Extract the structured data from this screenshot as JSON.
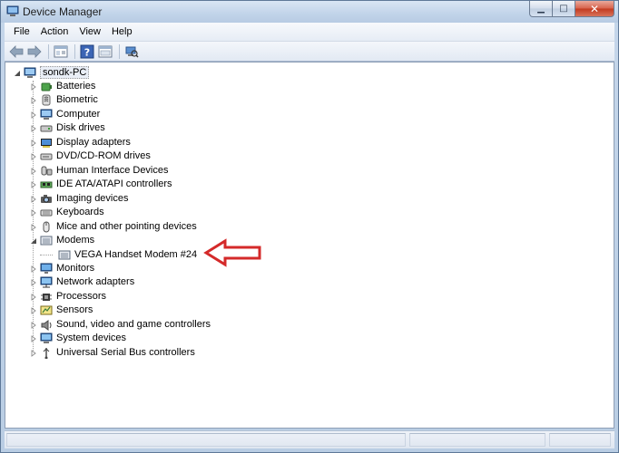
{
  "window": {
    "title": "Device Manager"
  },
  "caption": {
    "minimize": "▁",
    "maximize": "□",
    "close": "✕"
  },
  "menu": [
    "File",
    "Action",
    "View",
    "Help"
  ],
  "toolbar": [
    "back-arrow-icon",
    "forward-arrow-icon",
    "properties-icon",
    "help-icon",
    "show-hidden-icon",
    "scan-hardware-icon"
  ],
  "tree": {
    "root": "sondk-PC",
    "categories": [
      {
        "label": "Batteries",
        "icon": "battery-icon",
        "expanded": false
      },
      {
        "label": "Biometric",
        "icon": "biometric-icon",
        "expanded": false
      },
      {
        "label": "Computer",
        "icon": "computer-icon",
        "expanded": false
      },
      {
        "label": "Disk drives",
        "icon": "disk-drive-icon",
        "expanded": false
      },
      {
        "label": "Display adapters",
        "icon": "display-adapter-icon",
        "expanded": false
      },
      {
        "label": "DVD/CD-ROM drives",
        "icon": "dvd-drive-icon",
        "expanded": false
      },
      {
        "label": "Human Interface Devices",
        "icon": "hid-icon",
        "expanded": false
      },
      {
        "label": "IDE ATA/ATAPI controllers",
        "icon": "ide-controller-icon",
        "expanded": false
      },
      {
        "label": "Imaging devices",
        "icon": "camera-icon",
        "expanded": false
      },
      {
        "label": "Keyboards",
        "icon": "keyboard-icon",
        "expanded": false
      },
      {
        "label": "Mice and other pointing devices",
        "icon": "mouse-icon",
        "expanded": false
      },
      {
        "label": "Modems",
        "icon": "modem-icon",
        "expanded": true,
        "children": [
          "VEGA Handset Modem  #24"
        ]
      },
      {
        "label": "Monitors",
        "icon": "monitor-icon",
        "expanded": false
      },
      {
        "label": "Network adapters",
        "icon": "network-adapter-icon",
        "expanded": false
      },
      {
        "label": "Processors",
        "icon": "processor-icon",
        "expanded": false
      },
      {
        "label": "Sensors",
        "icon": "sensor-icon",
        "expanded": false
      },
      {
        "label": "Sound, video and game controllers",
        "icon": "speaker-icon",
        "expanded": false
      },
      {
        "label": "System devices",
        "icon": "system-devices-icon",
        "expanded": false
      },
      {
        "label": "Universal Serial Bus controllers",
        "icon": "usb-icon",
        "expanded": false
      }
    ]
  },
  "annotation": {
    "arrow_color": "#d42a2a",
    "points_to": "VEGA Handset Modem  #24"
  }
}
